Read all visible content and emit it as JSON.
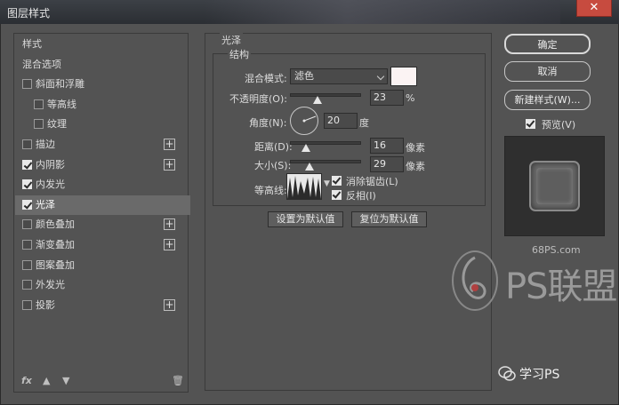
{
  "window": {
    "title": "图层样式",
    "close_label": "✕"
  },
  "left_panel": {
    "items": [
      {
        "label": "样式",
        "checkbox": null,
        "plus": false,
        "selected": false,
        "indent": 0
      },
      {
        "label": "混合选项",
        "checkbox": null,
        "plus": false,
        "selected": false,
        "indent": 0
      },
      {
        "label": "斜面和浮雕",
        "checkbox": false,
        "plus": false,
        "selected": false,
        "indent": 0
      },
      {
        "label": "等高线",
        "checkbox": false,
        "plus": false,
        "selected": false,
        "indent": 1
      },
      {
        "label": "纹理",
        "checkbox": false,
        "plus": false,
        "selected": false,
        "indent": 1
      },
      {
        "label": "描边",
        "checkbox": false,
        "plus": true,
        "selected": false,
        "indent": 0
      },
      {
        "label": "内阴影",
        "checkbox": true,
        "plus": true,
        "selected": false,
        "indent": 0
      },
      {
        "label": "内发光",
        "checkbox": true,
        "plus": false,
        "selected": false,
        "indent": 0
      },
      {
        "label": "光泽",
        "checkbox": true,
        "plus": false,
        "selected": true,
        "indent": 0
      },
      {
        "label": "颜色叠加",
        "checkbox": false,
        "plus": true,
        "selected": false,
        "indent": 0
      },
      {
        "label": "渐变叠加",
        "checkbox": false,
        "plus": true,
        "selected": false,
        "indent": 0
      },
      {
        "label": "图案叠加",
        "checkbox": false,
        "plus": false,
        "selected": false,
        "indent": 0
      },
      {
        "label": "外发光",
        "checkbox": false,
        "plus": false,
        "selected": false,
        "indent": 0
      },
      {
        "label": "投影",
        "checkbox": false,
        "plus": true,
        "selected": false,
        "indent": 0
      }
    ],
    "bottom": {
      "fx_label": "fx",
      "trash_icon": "trash-icon",
      "up_icon": "arrow-up-icon",
      "down_icon": "arrow-down-icon"
    }
  },
  "satin": {
    "group_title": "光泽",
    "structure_title": "结构",
    "blend_mode_label": "混合模式:",
    "blend_mode_value": "滤色",
    "swatch_color": "#fbf3f3",
    "opacity_label": "不透明度(O):",
    "opacity_value": "23",
    "opacity_unit": "%",
    "opacity_fraction": 0.23,
    "angle_label": "角度(N):",
    "angle_value": "20",
    "angle_unit": "度",
    "distance_label": "距离(D):",
    "distance_value": "16",
    "distance_unit": "像素",
    "distance_fraction": 0.064,
    "size_label": "大小(S):",
    "size_value": "29",
    "size_unit": "像素",
    "size_fraction": 0.116,
    "contour_label": "等高线:",
    "antialias_label": "消除锯齿(L)",
    "antialias_checked": true,
    "invert_label": "反相(I)",
    "invert_checked": true,
    "make_default_label": "设置为默认值",
    "reset_default_label": "复位为默认值"
  },
  "right_panel": {
    "ok_label": "确定",
    "cancel_label": "取消",
    "new_style_label": "新建样式(W)...",
    "preview_label": "预览(V)",
    "preview_checked": true
  },
  "watermark": {
    "site": "68PS.com",
    "logo_text": "PS联盟",
    "wechat_text": "学习PS"
  }
}
